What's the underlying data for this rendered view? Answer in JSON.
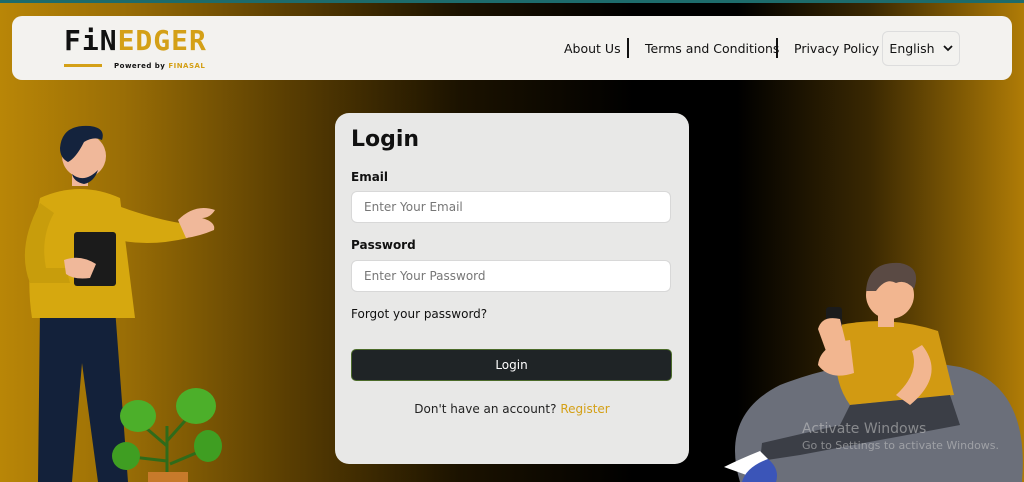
{
  "brand": {
    "logo_fin": "FiN",
    "logo_edger": "EDGER",
    "powered_prefix": "Powered by",
    "powered_brand": "FINASAL"
  },
  "nav": {
    "about": "About Us",
    "terms": "Terms and Conditions",
    "privacy": "Privacy Policy",
    "language": "English"
  },
  "login": {
    "title": "Login",
    "email_label": "Email",
    "email_placeholder": "Enter Your Email",
    "email_value": "",
    "password_label": "Password",
    "password_placeholder": "Enter Your Password",
    "password_value": "",
    "forgot": "Forgot your password?",
    "button": "Login",
    "register_prompt": "Don't have an account?",
    "register_link": "Register"
  },
  "watermark": {
    "line1": "Activate Windows",
    "line2": "Go to Settings to activate Windows."
  },
  "colors": {
    "accent": "#d4a017",
    "button": "#1f2426",
    "header_bg": "#f3f2ef",
    "card_bg": "#e8e8e7"
  },
  "icons": [
    "chevron-down-icon"
  ]
}
